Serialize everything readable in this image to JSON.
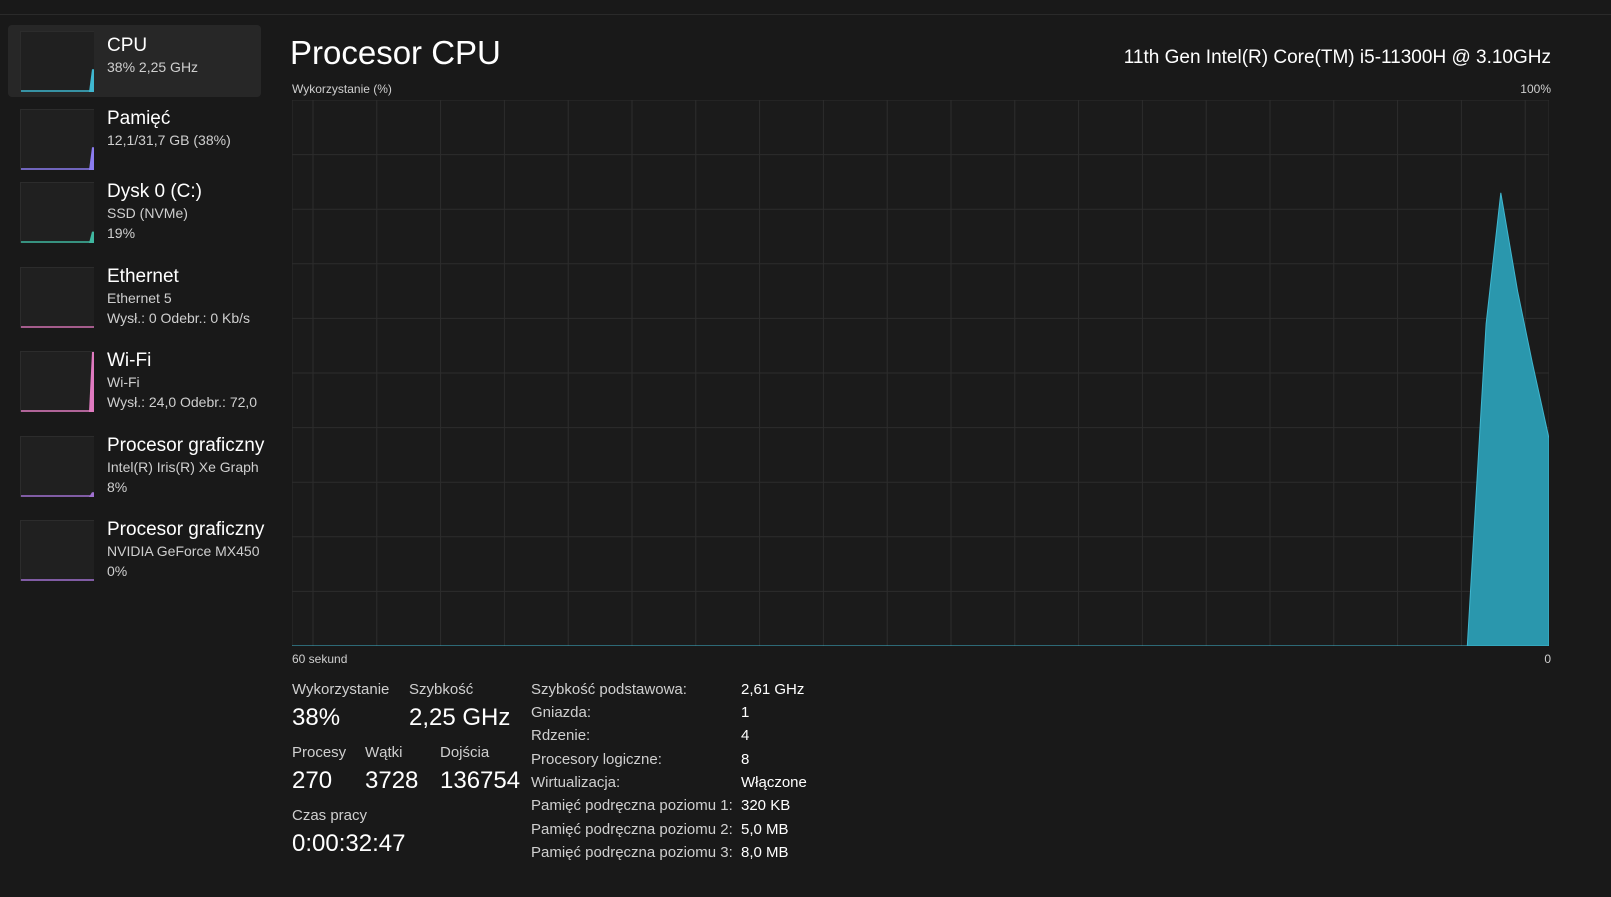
{
  "sidebar": {
    "items": [
      {
        "title": "CPU",
        "line1": "38%  2,25 GHz",
        "line2": "",
        "color": "#3fb7d0",
        "selected": true,
        "level": 0.38
      },
      {
        "title": "Pamięć",
        "line1": "12,1/31,7 GB (38%)",
        "line2": "",
        "color": "#8b7cf0",
        "selected": false,
        "level": 0.38
      },
      {
        "title": "Dysk 0 (C:)",
        "line1": "SSD (NVMe)",
        "line2": "19%",
        "color": "#3fb7a0",
        "selected": false,
        "level": 0.19
      },
      {
        "title": "Ethernet",
        "line1": "Ethernet 5",
        "line2": "Wysł.: 0 Odebr.: 0 Kb/s",
        "color": "#d070b0",
        "selected": false,
        "level": 0.0
      },
      {
        "title": "Wi-Fi",
        "line1": "Wi-Fi",
        "line2": "Wysł.: 24,0 Odebr.: 72,0",
        "color": "#e07ac0",
        "selected": false,
        "level": 1.0
      },
      {
        "title": "Procesor graficzny",
        "line1": "Intel(R) Iris(R) Xe Graph",
        "line2": "8%",
        "color": "#a070d0",
        "selected": false,
        "level": 0.08
      },
      {
        "title": "Procesor graficzny",
        "line1": "NVIDIA GeForce MX450",
        "line2": "0%",
        "color": "#a070d0",
        "selected": false,
        "level": 0.0
      }
    ]
  },
  "main": {
    "title": "Procesor CPU",
    "model": "11th Gen Intel(R) Core(TM) i5-11300H @ 3.10GHz",
    "graph_label": "Wykorzystanie (%)",
    "graph_max": "100%",
    "graph_time": "60 sekund",
    "graph_min": "0",
    "graph_color": "#2a97ad",
    "graph_stroke": "#3fb7d0"
  },
  "chart_data": {
    "type": "area",
    "ylabel": "Wykorzystanie (%)",
    "ylim": [
      0,
      100
    ],
    "x_seconds_ago": [
      60,
      57,
      54,
      51,
      48,
      45,
      42,
      39,
      36,
      33,
      30,
      27,
      24,
      21,
      18,
      15,
      12,
      9,
      6,
      3.9,
      3,
      2.3,
      1.5,
      0.8,
      0
    ],
    "values": [
      0,
      0,
      0,
      0,
      0,
      0,
      0,
      0,
      0,
      0,
      0,
      0,
      0,
      0,
      0,
      0,
      0,
      0,
      0,
      0,
      59,
      83,
      65,
      52,
      38
    ],
    "grid": true
  },
  "stats": {
    "usage_label": "Wykorzystanie",
    "usage_value": "38%",
    "speed_label": "Szybkość",
    "speed_value": "2,25 GHz",
    "processes_label": "Procesy",
    "processes_value": "270",
    "threads_label": "Wątki",
    "threads_value": "3728",
    "handles_label": "Dojścia",
    "handles_value": "136754",
    "uptime_label": "Czas pracy",
    "uptime_value": "0:00:32:47"
  },
  "specs": [
    {
      "label": "Szybkość podstawowa:",
      "value": "2,61 GHz"
    },
    {
      "label": "Gniazda:",
      "value": "1"
    },
    {
      "label": "Rdzenie:",
      "value": "4"
    },
    {
      "label": "Procesory logiczne:",
      "value": "8"
    },
    {
      "label": "Wirtualizacja:",
      "value": "Włączone"
    },
    {
      "label": "Pamięć podręczna poziomu 1:",
      "value": "320 KB"
    },
    {
      "label": "Pamięć podręczna poziomu 2:",
      "value": "5,0 MB"
    },
    {
      "label": "Pamięć podręczna poziomu 3:",
      "value": "8,0 MB"
    }
  ]
}
